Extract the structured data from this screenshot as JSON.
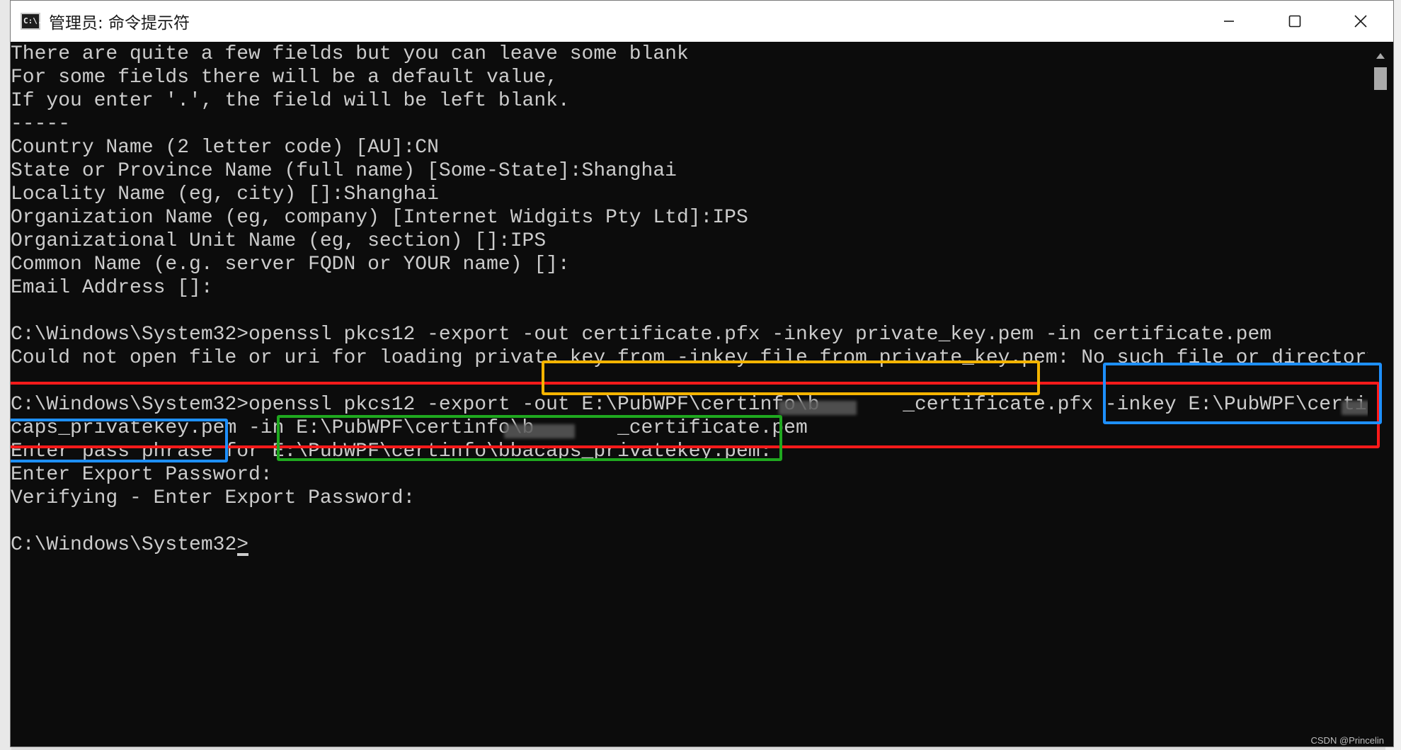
{
  "window": {
    "title": "管理员: 命令提示符",
    "app_icon": "C:\\.",
    "controls": [
      {
        "name": "minimize-button",
        "icon": "minimize-icon"
      },
      {
        "name": "maximize-button",
        "icon": "maximize-icon"
      },
      {
        "name": "close-button",
        "icon": "close-icon"
      }
    ]
  },
  "terminal": {
    "lines": [
      "There are quite a few fields but you can leave some blank",
      "For some fields there will be a default value,",
      "If you enter '.', the field will be left blank.",
      "-----",
      "Country Name (2 letter code) [AU]:CN",
      "State or Province Name (full name) [Some-State]:Shanghai",
      "Locality Name (eg, city) []:Shanghai",
      "Organization Name (eg, company) [Internet Widgits Pty Ltd]:IPS",
      "Organizational Unit Name (eg, section) []:IPS",
      "Common Name (e.g. server FQDN or YOUR name) []:",
      "Email Address []:",
      "",
      "C:\\Windows\\System32>openssl pkcs12 -export -out certificate.pfx -inkey private_key.pem -in certificate.pem",
      "Could not open file or uri for loading private key from -inkey file from private_key.pem: No such file or directory",
      "",
      "C:\\Windows\\System32>openssl pkcs12 -export -out E:\\PubWPF\\certinfo\\b       _certificate.pfx -inkey E:\\PubWPF\\certinfo\\b  ",
      "caps_privatekey.pem -in E:\\PubWPF\\certinfo\\b       _certificate.pem",
      "Enter pass phrase for E:\\PubWPF\\certinfo\\bbacaps_privatekey.pem:",
      "Enter Export Password:",
      "Verifying - Enter Export Password:",
      "",
      "C:\\Windows\\System32>"
    ],
    "foreground": "#cccccc",
    "background": "#0c0c0c"
  },
  "annotations": {
    "colors": {
      "red": "#ff1a1a",
      "orange": "#f5b400",
      "blue": "#1e90ff",
      "green": "#1fa81f"
    }
  },
  "watermark": "CSDN @Princelin"
}
